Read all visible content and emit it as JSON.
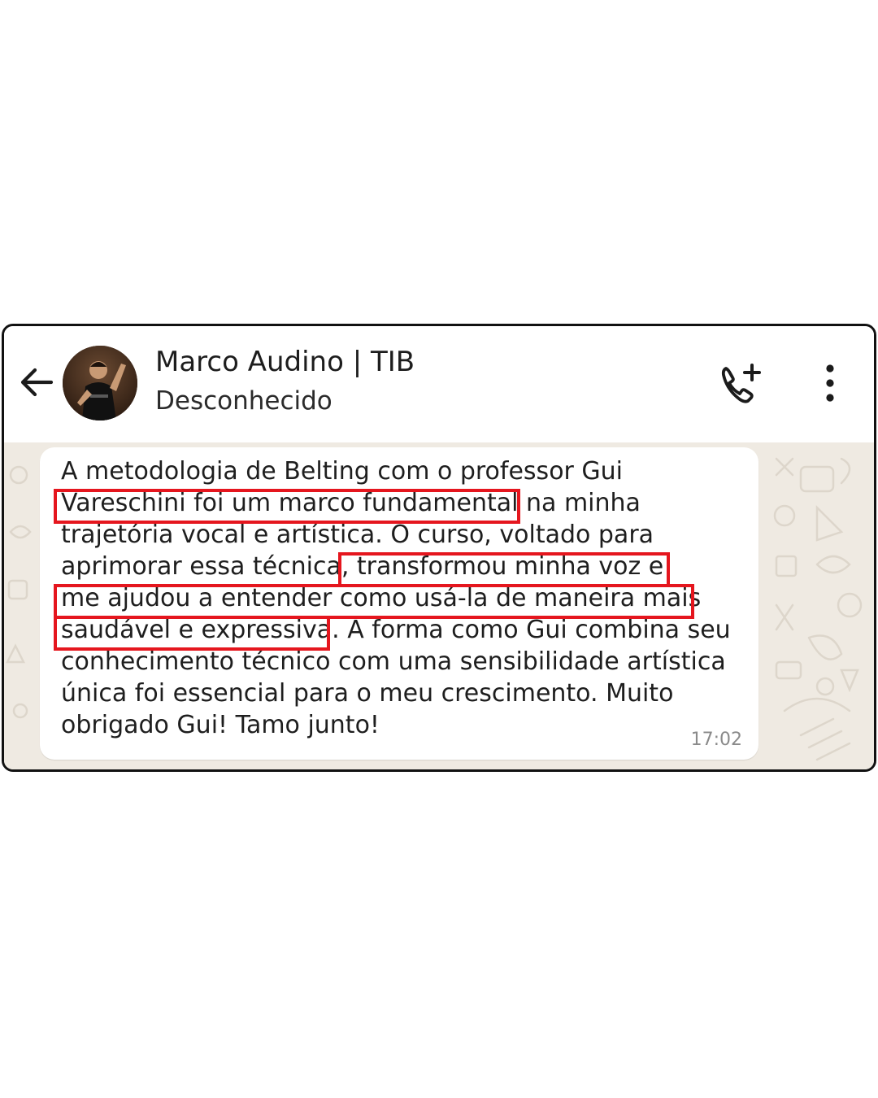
{
  "header": {
    "contact_name": "Marco Audino | TIB",
    "contact_status": "Desconhecido",
    "back_icon": "arrow-left-icon",
    "call_icon": "add-call-icon",
    "menu_icon": "more-vertical-icon"
  },
  "message": {
    "lines": [
      "A metodologia de Belting com o professor Gui",
      "Vareschini foi um marco fundamental na minha",
      "trajetória vocal e artística. O curso, voltado para",
      "aprimorar essa técnica, transformou minha voz e",
      "me ajudou a entender como usá-la de maneira mais",
      "saudável e expressiva. A forma como Gui combina seu",
      "conhecimento técnico com uma sensibilidade artística",
      "única foi essencial para o meu crescimento. Muito",
      "obrigado Gui! Tamo junto!"
    ],
    "time": "17:02"
  },
  "colors": {
    "highlight": "#e5161e",
    "chat_background": "#efeae2",
    "bubble": "#ffffff"
  }
}
